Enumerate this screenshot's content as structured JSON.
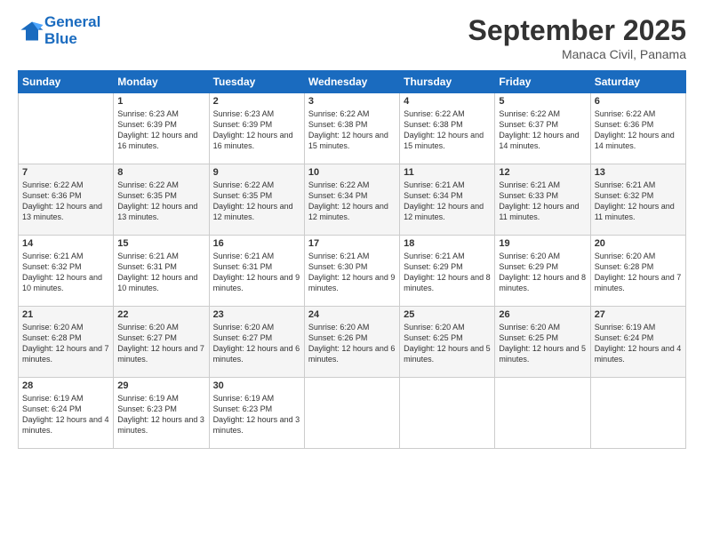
{
  "header": {
    "logo_line1": "General",
    "logo_line2": "Blue",
    "month_title": "September 2025",
    "location": "Manaca Civil, Panama"
  },
  "days": [
    "Sunday",
    "Monday",
    "Tuesday",
    "Wednesday",
    "Thursday",
    "Friday",
    "Saturday"
  ],
  "weeks": [
    [
      {
        "date": "",
        "sunrise": "",
        "sunset": "",
        "daylight": ""
      },
      {
        "date": "1",
        "sunrise": "Sunrise: 6:23 AM",
        "sunset": "Sunset: 6:39 PM",
        "daylight": "Daylight: 12 hours and 16 minutes."
      },
      {
        "date": "2",
        "sunrise": "Sunrise: 6:23 AM",
        "sunset": "Sunset: 6:39 PM",
        "daylight": "Daylight: 12 hours and 16 minutes."
      },
      {
        "date": "3",
        "sunrise": "Sunrise: 6:22 AM",
        "sunset": "Sunset: 6:38 PM",
        "daylight": "Daylight: 12 hours and 15 minutes."
      },
      {
        "date": "4",
        "sunrise": "Sunrise: 6:22 AM",
        "sunset": "Sunset: 6:38 PM",
        "daylight": "Daylight: 12 hours and 15 minutes."
      },
      {
        "date": "5",
        "sunrise": "Sunrise: 6:22 AM",
        "sunset": "Sunset: 6:37 PM",
        "daylight": "Daylight: 12 hours and 14 minutes."
      },
      {
        "date": "6",
        "sunrise": "Sunrise: 6:22 AM",
        "sunset": "Sunset: 6:36 PM",
        "daylight": "Daylight: 12 hours and 14 minutes."
      }
    ],
    [
      {
        "date": "7",
        "sunrise": "Sunrise: 6:22 AM",
        "sunset": "Sunset: 6:36 PM",
        "daylight": "Daylight: 12 hours and 13 minutes."
      },
      {
        "date": "8",
        "sunrise": "Sunrise: 6:22 AM",
        "sunset": "Sunset: 6:35 PM",
        "daylight": "Daylight: 12 hours and 13 minutes."
      },
      {
        "date": "9",
        "sunrise": "Sunrise: 6:22 AM",
        "sunset": "Sunset: 6:35 PM",
        "daylight": "Daylight: 12 hours and 12 minutes."
      },
      {
        "date": "10",
        "sunrise": "Sunrise: 6:22 AM",
        "sunset": "Sunset: 6:34 PM",
        "daylight": "Daylight: 12 hours and 12 minutes."
      },
      {
        "date": "11",
        "sunrise": "Sunrise: 6:21 AM",
        "sunset": "Sunset: 6:34 PM",
        "daylight": "Daylight: 12 hours and 12 minutes."
      },
      {
        "date": "12",
        "sunrise": "Sunrise: 6:21 AM",
        "sunset": "Sunset: 6:33 PM",
        "daylight": "Daylight: 12 hours and 11 minutes."
      },
      {
        "date": "13",
        "sunrise": "Sunrise: 6:21 AM",
        "sunset": "Sunset: 6:32 PM",
        "daylight": "Daylight: 12 hours and 11 minutes."
      }
    ],
    [
      {
        "date": "14",
        "sunrise": "Sunrise: 6:21 AM",
        "sunset": "Sunset: 6:32 PM",
        "daylight": "Daylight: 12 hours and 10 minutes."
      },
      {
        "date": "15",
        "sunrise": "Sunrise: 6:21 AM",
        "sunset": "Sunset: 6:31 PM",
        "daylight": "Daylight: 12 hours and 10 minutes."
      },
      {
        "date": "16",
        "sunrise": "Sunrise: 6:21 AM",
        "sunset": "Sunset: 6:31 PM",
        "daylight": "Daylight: 12 hours and 9 minutes."
      },
      {
        "date": "17",
        "sunrise": "Sunrise: 6:21 AM",
        "sunset": "Sunset: 6:30 PM",
        "daylight": "Daylight: 12 hours and 9 minutes."
      },
      {
        "date": "18",
        "sunrise": "Sunrise: 6:21 AM",
        "sunset": "Sunset: 6:29 PM",
        "daylight": "Daylight: 12 hours and 8 minutes."
      },
      {
        "date": "19",
        "sunrise": "Sunrise: 6:20 AM",
        "sunset": "Sunset: 6:29 PM",
        "daylight": "Daylight: 12 hours and 8 minutes."
      },
      {
        "date": "20",
        "sunrise": "Sunrise: 6:20 AM",
        "sunset": "Sunset: 6:28 PM",
        "daylight": "Daylight: 12 hours and 7 minutes."
      }
    ],
    [
      {
        "date": "21",
        "sunrise": "Sunrise: 6:20 AM",
        "sunset": "Sunset: 6:28 PM",
        "daylight": "Daylight: 12 hours and 7 minutes."
      },
      {
        "date": "22",
        "sunrise": "Sunrise: 6:20 AM",
        "sunset": "Sunset: 6:27 PM",
        "daylight": "Daylight: 12 hours and 7 minutes."
      },
      {
        "date": "23",
        "sunrise": "Sunrise: 6:20 AM",
        "sunset": "Sunset: 6:27 PM",
        "daylight": "Daylight: 12 hours and 6 minutes."
      },
      {
        "date": "24",
        "sunrise": "Sunrise: 6:20 AM",
        "sunset": "Sunset: 6:26 PM",
        "daylight": "Daylight: 12 hours and 6 minutes."
      },
      {
        "date": "25",
        "sunrise": "Sunrise: 6:20 AM",
        "sunset": "Sunset: 6:25 PM",
        "daylight": "Daylight: 12 hours and 5 minutes."
      },
      {
        "date": "26",
        "sunrise": "Sunrise: 6:20 AM",
        "sunset": "Sunset: 6:25 PM",
        "daylight": "Daylight: 12 hours and 5 minutes."
      },
      {
        "date": "27",
        "sunrise": "Sunrise: 6:19 AM",
        "sunset": "Sunset: 6:24 PM",
        "daylight": "Daylight: 12 hours and 4 minutes."
      }
    ],
    [
      {
        "date": "28",
        "sunrise": "Sunrise: 6:19 AM",
        "sunset": "Sunset: 6:24 PM",
        "daylight": "Daylight: 12 hours and 4 minutes."
      },
      {
        "date": "29",
        "sunrise": "Sunrise: 6:19 AM",
        "sunset": "Sunset: 6:23 PM",
        "daylight": "Daylight: 12 hours and 3 minutes."
      },
      {
        "date": "30",
        "sunrise": "Sunrise: 6:19 AM",
        "sunset": "Sunset: 6:23 PM",
        "daylight": "Daylight: 12 hours and 3 minutes."
      },
      {
        "date": "",
        "sunrise": "",
        "sunset": "",
        "daylight": ""
      },
      {
        "date": "",
        "sunrise": "",
        "sunset": "",
        "daylight": ""
      },
      {
        "date": "",
        "sunrise": "",
        "sunset": "",
        "daylight": ""
      },
      {
        "date": "",
        "sunrise": "",
        "sunset": "",
        "daylight": ""
      }
    ]
  ]
}
